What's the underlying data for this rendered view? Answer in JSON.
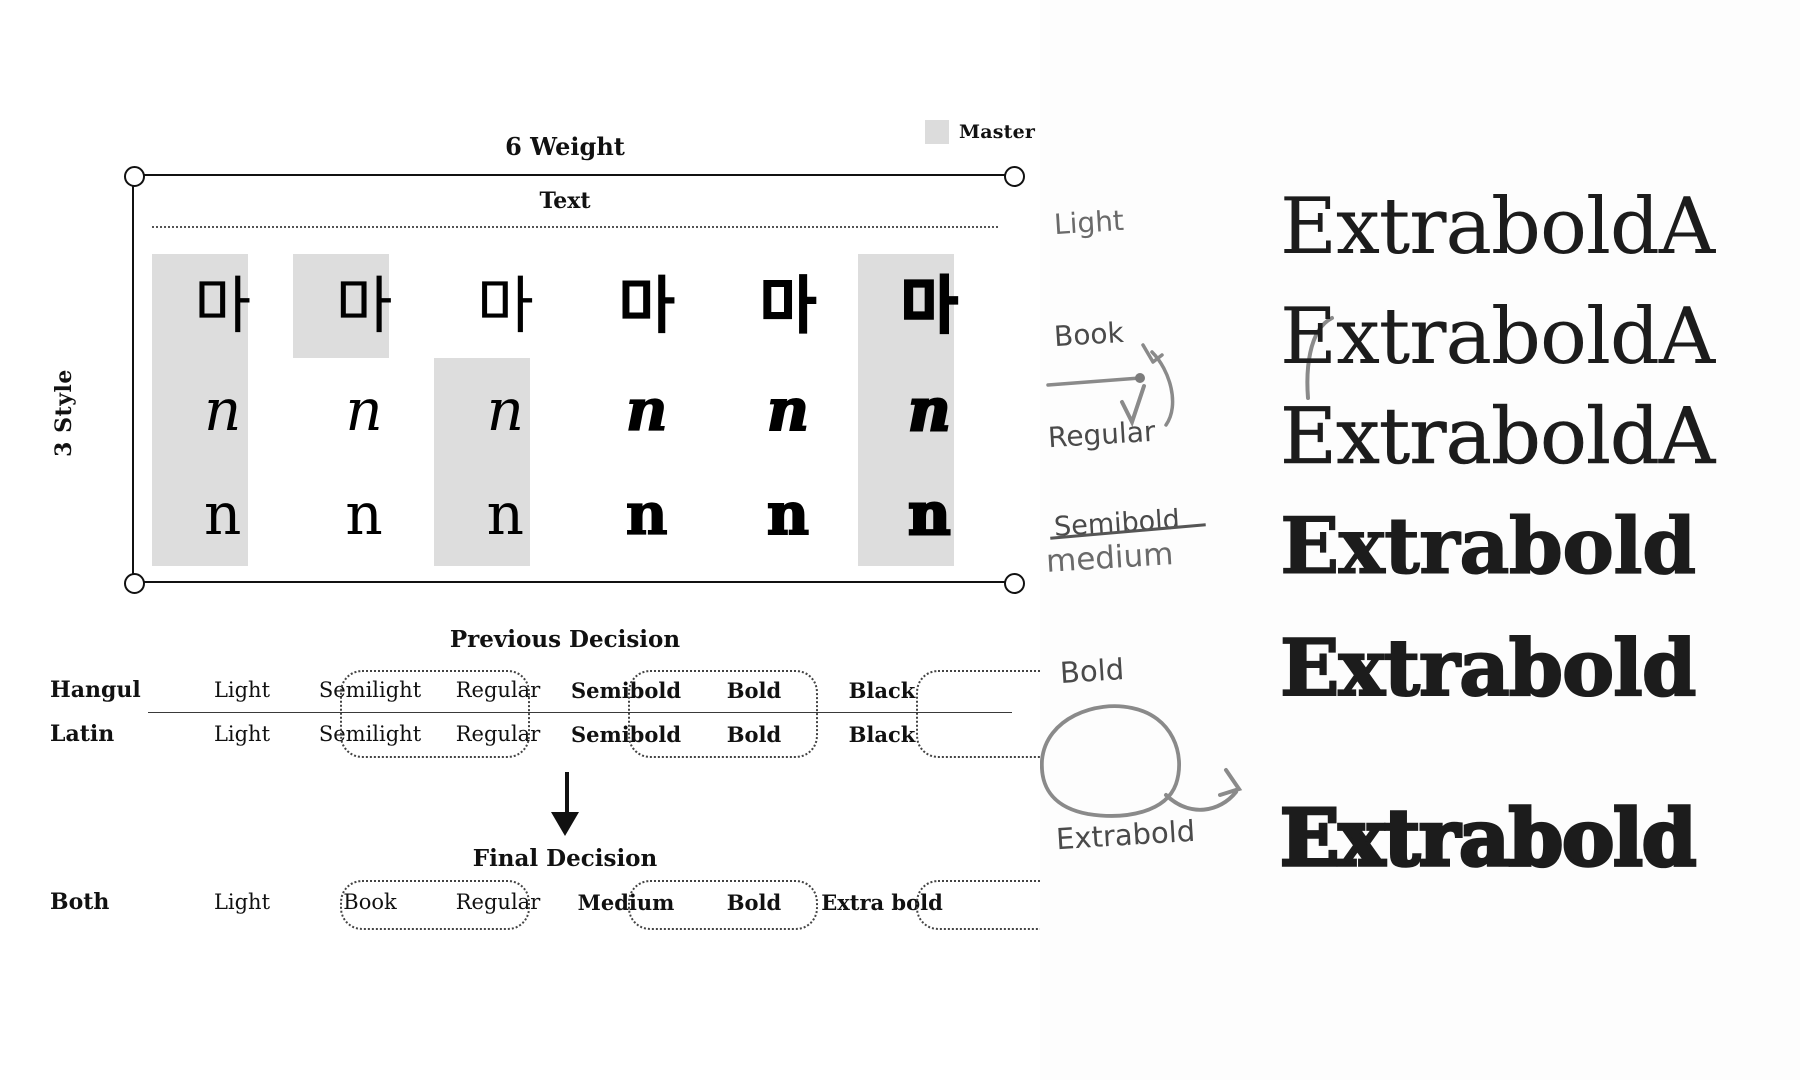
{
  "diagram": {
    "legend": {
      "label": "Master",
      "swatch_color": "#dddddd"
    },
    "top_axis_label": "6 Weight",
    "side_axis_label": "3 Style",
    "category_label": "Text",
    "columns": [
      {
        "index": 1,
        "master": "full"
      },
      {
        "index": 2,
        "master": "hangul"
      },
      {
        "index": 3,
        "master": "latin"
      },
      {
        "index": 4,
        "master": "none"
      },
      {
        "index": 5,
        "master": "none"
      },
      {
        "index": 6,
        "master": "full"
      }
    ],
    "rows": [
      {
        "name": "hangul",
        "glyph": "마"
      },
      {
        "name": "latin-italic",
        "glyph": "n"
      },
      {
        "name": "latin-roman",
        "glyph": "n"
      }
    ]
  },
  "previous_decision": {
    "title": "Previous Decision",
    "rows": [
      {
        "language": "Hangul",
        "weights": [
          "Light",
          "Semilight",
          "Regular",
          "Semibold",
          "Bold",
          "Black"
        ]
      },
      {
        "language": "Latin",
        "weights": [
          "Light",
          "Semilight",
          "Regular",
          "Semibold",
          "Bold",
          "Black"
        ]
      }
    ],
    "highlighted_weights": [
      "Semilight",
      "Semibold",
      "Black"
    ]
  },
  "final_decision": {
    "title": "Final Decision",
    "rows": [
      {
        "language": "Both",
        "weights": [
          "Light",
          "Book",
          "Regular",
          "Medium",
          "Bold",
          "Extra bold"
        ]
      }
    ],
    "highlighted_weights": [
      "Book",
      "Medium",
      "Extra bold"
    ]
  },
  "specimen_sheet": {
    "specimens": [
      {
        "text": "ExtraboldA",
        "weight": 300,
        "annotation": "Light",
        "struck": false
      },
      {
        "text": "ExtraboldA",
        "weight": 400,
        "annotation": "Book",
        "struck": false
      },
      {
        "text": "ExtraboldA",
        "weight": 500,
        "annotation": "Regular",
        "struck": false
      },
      {
        "text": "Extrabold",
        "weight": 700,
        "annotation": "Semibold",
        "annotation_replacement": "medium",
        "struck": true
      },
      {
        "text": "Extrabold",
        "weight": 800,
        "annotation": "Bold",
        "struck": false
      },
      {
        "text": "Extrabold",
        "weight": 900,
        "annotation": "Extrabold",
        "struck": false,
        "circled": true
      }
    ]
  }
}
